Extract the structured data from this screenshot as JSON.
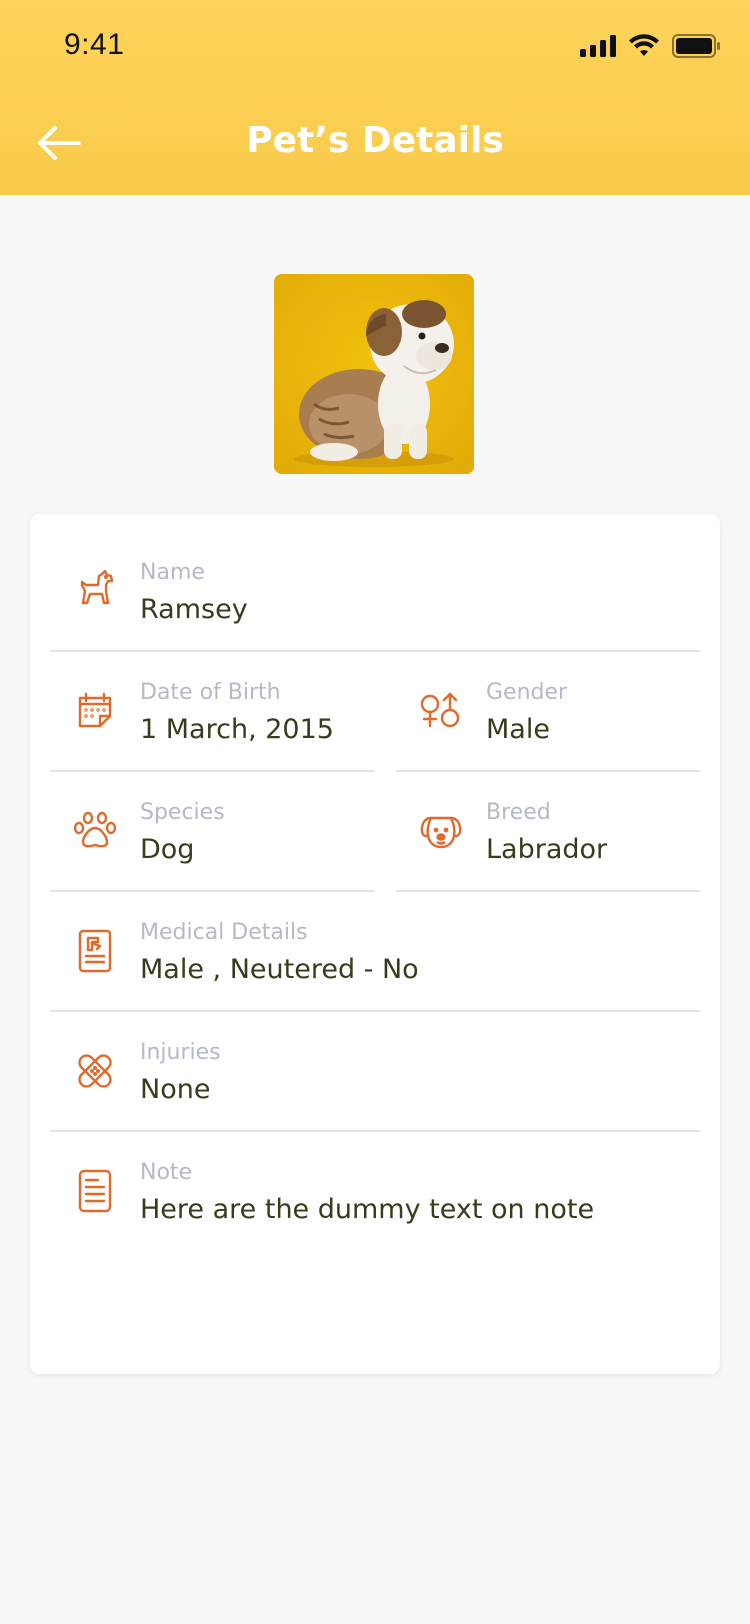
{
  "status_bar": {
    "time": "9:41"
  },
  "header": {
    "title": "Pet’s Details"
  },
  "pet": {
    "name": {
      "label": "Name",
      "value": "Ramsey"
    },
    "dob": {
      "label": "Date of Birth",
      "value": "1 March, 2015"
    },
    "gender": {
      "label": "Gender",
      "value": "Male"
    },
    "species": {
      "label": "Species",
      "value": "Dog"
    },
    "breed": {
      "label": "Breed",
      "value": "Labrador"
    },
    "medical": {
      "label": "Medical Details",
      "value": "Male , Neutered - No"
    },
    "injuries": {
      "label": "Injuries",
      "value": "None"
    },
    "note": {
      "label": "Note",
      "value": "Here are the dummy text on note"
    }
  },
  "colors": {
    "header": "#fdd35a",
    "icon": "#e06a2c",
    "label": "#b4b9c8",
    "value": "#3a3a1d"
  }
}
